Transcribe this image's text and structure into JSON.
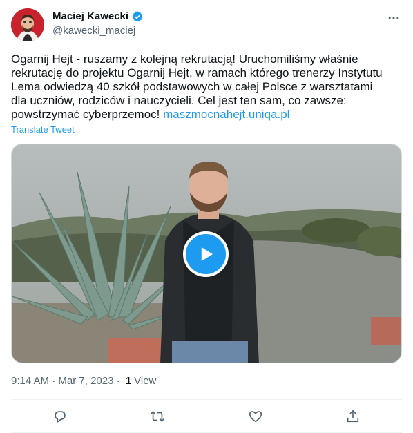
{
  "author": {
    "name": "Maciej Kawecki",
    "handle": "@kawecki_maciej",
    "verified": true,
    "verified_color": "#1d9bf0"
  },
  "tweet": {
    "text": "Ogarnij Hejt - ruszamy z kolejną rekrutacją! Uruchomiliśmy właśnie\nrekrutację do projektu Ogarnij Hejt, w ramach którego trenerzy Instytutu\nLema odwiedzą 40 szkół podstawowych w całej Polsce z warsztatami\ndla uczniów, rodziców i nauczycieli. Cel jest ten sam, co zawsze:\npowstrzymać cyberprzemoc! ",
    "link": "maszmocnahejt.uniqa.pl",
    "translate_label": "Translate Tweet"
  },
  "media": {
    "type": "video",
    "play_icon": "play-icon"
  },
  "meta": {
    "time": "9:14 AM",
    "separator": " · ",
    "date": "Mar 7, 2023",
    "views_count": "1",
    "views_label": "View"
  },
  "actions": [
    {
      "name": "reply",
      "icon": "reply-icon"
    },
    {
      "name": "retweet",
      "icon": "retweet-icon"
    },
    {
      "name": "like",
      "icon": "like-icon"
    },
    {
      "name": "share",
      "icon": "share-icon"
    }
  ],
  "colors": {
    "accent": "#1d9bf0",
    "text": "#0f1419",
    "secondary": "#536471"
  }
}
